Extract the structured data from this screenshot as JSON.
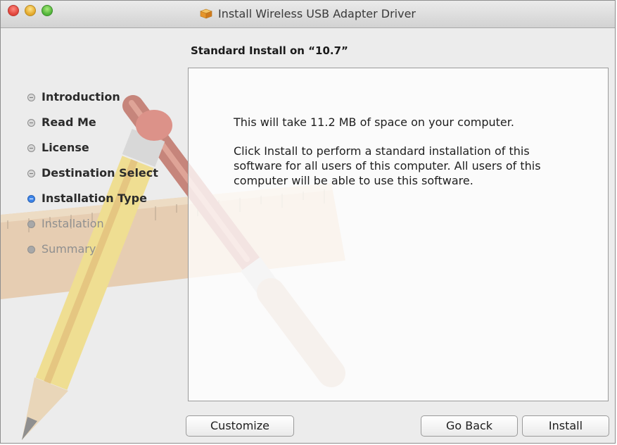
{
  "window": {
    "title": "Install Wireless USB Adapter Driver",
    "title_icon": "package-icon",
    "controls": [
      "close",
      "minimize",
      "zoom"
    ]
  },
  "heading": "Standard Install on “10.7”",
  "steps": [
    {
      "label": "Introduction",
      "state": "done"
    },
    {
      "label": "Read Me",
      "state": "done"
    },
    {
      "label": "License",
      "state": "done"
    },
    {
      "label": "Destination Select",
      "state": "done"
    },
    {
      "label": "Installation Type",
      "state": "current"
    },
    {
      "label": "Installation",
      "state": "pending"
    },
    {
      "label": "Summary",
      "state": "pending"
    }
  ],
  "panel": {
    "space_text": "This will take 11.2 MB of space on your computer.",
    "description": "Click Install to perform a standard installation of this software for all users of this computer. All users of this computer will be able to use this software."
  },
  "buttons": {
    "customize": "Customize",
    "go_back": "Go Back",
    "install": "Install"
  },
  "colors": {
    "current_step": "#3f86ea",
    "close": "#e0443b",
    "minimize": "#e3a82b",
    "zoom": "#51b33a"
  }
}
